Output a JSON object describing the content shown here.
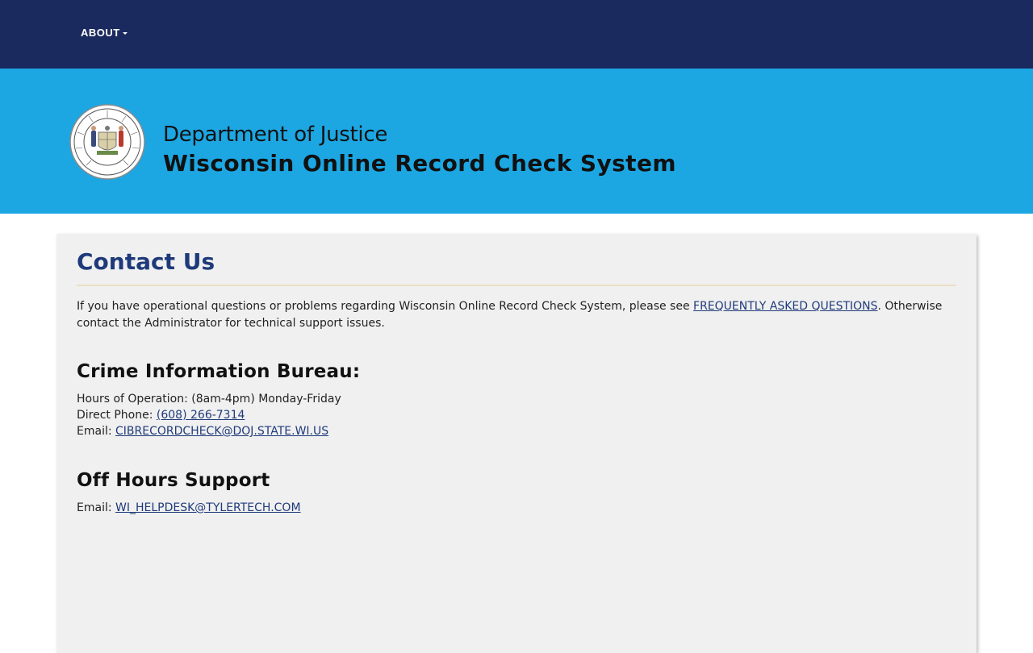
{
  "nav": {
    "about_label": "ABOUT"
  },
  "header": {
    "department": "Department of Justice",
    "system_title": "Wisconsin Online Record Check System"
  },
  "contact": {
    "title": "Contact Us",
    "intro_text_1": "If you have operational questions or problems regarding Wisconsin Online Record Check System, please see ",
    "faq_link": "FREQUENTLY ASKED QUESTIONS",
    "intro_text_2": ". Otherwise contact the Administrator for technical support issues.",
    "cib": {
      "heading": "Crime Information Bureau:",
      "hours": "Hours of Operation: (8am-4pm) Monday-Friday",
      "phone_label": "Direct Phone: ",
      "phone": "(608) 266-7314",
      "email_label": "Email: ",
      "email": "CIBRECORDCHECK@DOJ.STATE.WI.US"
    },
    "off_hours": {
      "heading": "Off Hours Support",
      "email_label": "Email: ",
      "email": "WI_HELPDESK@TYLERTECH.COM"
    }
  },
  "colors": {
    "nav_bg": "#1b2a5e",
    "banner_bg": "#1ca7e3",
    "title_blue": "#1f3a7a",
    "card_bg": "#f0f0f0"
  },
  "icons": {
    "seal": "wisconsin-doj-seal-icon"
  }
}
